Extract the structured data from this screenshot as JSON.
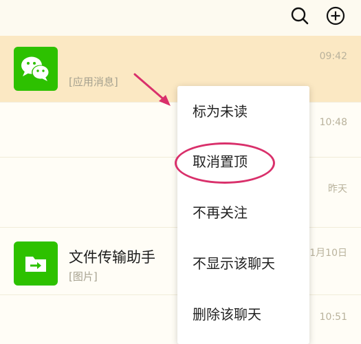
{
  "header": {
    "search_icon": "search-icon",
    "add_icon": "plus-circle-icon"
  },
  "chats": [
    {
      "name": "",
      "preview": "[应用消息]",
      "time": "09:42",
      "pinned": true,
      "icon": "wechat-bubbles-icon"
    },
    {
      "name": "",
      "preview": "",
      "time": "10:48",
      "pinned": false
    },
    {
      "name": "",
      "preview": "",
      "time": "昨天",
      "pinned": false
    },
    {
      "name": "文件传输助手",
      "preview": "[图片]",
      "time": "11月10日",
      "pinned": false,
      "icon": "file-transfer-icon"
    },
    {
      "name": "",
      "preview": "",
      "time": "10:51",
      "pinned": false
    }
  ],
  "context_menu": {
    "items": [
      "标为未读",
      "取消置顶",
      "不再关注",
      "不显示该聊天",
      "删除该聊天"
    ],
    "highlighted_index": 1
  },
  "colors": {
    "background": "#fdfaf0",
    "pinned_row": "#fbe8c3",
    "wechat_green": "#2dc100",
    "annotation": "#d9306b"
  }
}
